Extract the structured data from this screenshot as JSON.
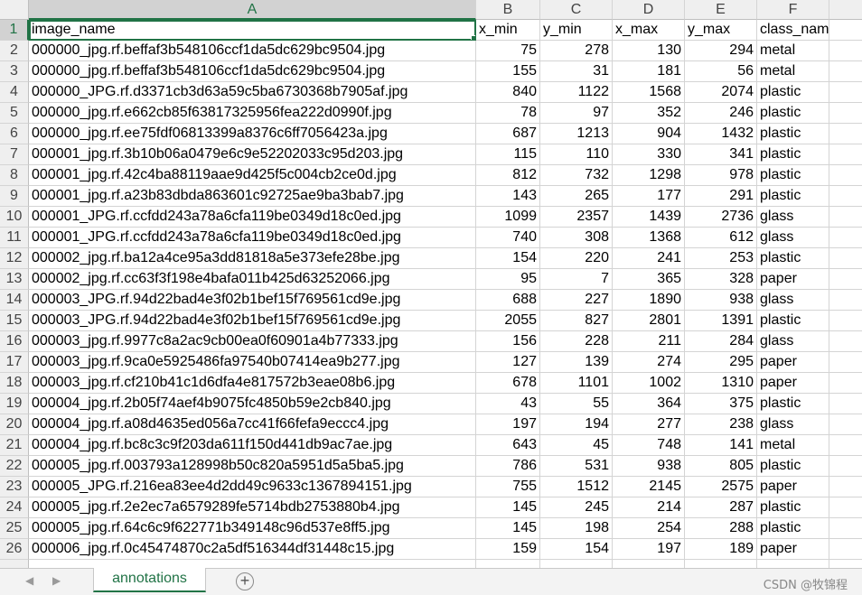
{
  "columns": [
    "A",
    "B",
    "C",
    "D",
    "E",
    "F"
  ],
  "header_row": {
    "num": "1",
    "image_name": "image_name",
    "x_min": "x_min",
    "y_min": "y_min",
    "x_max": "x_max",
    "y_max": "y_max",
    "class_name": "class_name"
  },
  "rows": [
    {
      "num": "2",
      "image_name": "000000_jpg.rf.beffaf3b548106ccf1da5dc629bc9504.jpg",
      "x_min": "75",
      "y_min": "278",
      "x_max": "130",
      "y_max": "294",
      "class_name": "metal"
    },
    {
      "num": "3",
      "image_name": "000000_jpg.rf.beffaf3b548106ccf1da5dc629bc9504.jpg",
      "x_min": "155",
      "y_min": "31",
      "x_max": "181",
      "y_max": "56",
      "class_name": "metal"
    },
    {
      "num": "4",
      "image_name": "000000_JPG.rf.d3371cb3d63a59c5ba6730368b7905af.jpg",
      "x_min": "840",
      "y_min": "1122",
      "x_max": "1568",
      "y_max": "2074",
      "class_name": "plastic"
    },
    {
      "num": "5",
      "image_name": "000000_jpg.rf.e662cb85f63817325956fea222d0990f.jpg",
      "x_min": "78",
      "y_min": "97",
      "x_max": "352",
      "y_max": "246",
      "class_name": "plastic"
    },
    {
      "num": "6",
      "image_name": "000000_jpg.rf.ee75fdf06813399a8376c6ff7056423a.jpg",
      "x_min": "687",
      "y_min": "1213",
      "x_max": "904",
      "y_max": "1432",
      "class_name": "plastic"
    },
    {
      "num": "7",
      "image_name": "000001_jpg.rf.3b10b06a0479e6c9e52202033c95d203.jpg",
      "x_min": "115",
      "y_min": "110",
      "x_max": "330",
      "y_max": "341",
      "class_name": "plastic"
    },
    {
      "num": "8",
      "image_name": "000001_jpg.rf.42c4ba88119aae9d425f5c004cb2ce0d.jpg",
      "x_min": "812",
      "y_min": "732",
      "x_max": "1298",
      "y_max": "978",
      "class_name": "plastic"
    },
    {
      "num": "9",
      "image_name": "000001_jpg.rf.a23b83dbda863601c92725ae9ba3bab7.jpg",
      "x_min": "143",
      "y_min": "265",
      "x_max": "177",
      "y_max": "291",
      "class_name": "plastic"
    },
    {
      "num": "10",
      "image_name": "000001_JPG.rf.ccfdd243a78a6cfa119be0349d18c0ed.jpg",
      "x_min": "1099",
      "y_min": "2357",
      "x_max": "1439",
      "y_max": "2736",
      "class_name": "glass"
    },
    {
      "num": "11",
      "image_name": "000001_JPG.rf.ccfdd243a78a6cfa119be0349d18c0ed.jpg",
      "x_min": "740",
      "y_min": "308",
      "x_max": "1368",
      "y_max": "612",
      "class_name": "glass"
    },
    {
      "num": "12",
      "image_name": "000002_jpg.rf.ba12a4ce95a3dd81818a5e373efe28be.jpg",
      "x_min": "154",
      "y_min": "220",
      "x_max": "241",
      "y_max": "253",
      "class_name": "plastic"
    },
    {
      "num": "13",
      "image_name": "000002_jpg.rf.cc63f3f198e4bafa011b425d63252066.jpg",
      "x_min": "95",
      "y_min": "7",
      "x_max": "365",
      "y_max": "328",
      "class_name": "paper"
    },
    {
      "num": "14",
      "image_name": "000003_JPG.rf.94d22bad4e3f02b1bef15f769561cd9e.jpg",
      "x_min": "688",
      "y_min": "227",
      "x_max": "1890",
      "y_max": "938",
      "class_name": "glass"
    },
    {
      "num": "15",
      "image_name": "000003_JPG.rf.94d22bad4e3f02b1bef15f769561cd9e.jpg",
      "x_min": "2055",
      "y_min": "827",
      "x_max": "2801",
      "y_max": "1391",
      "class_name": "plastic"
    },
    {
      "num": "16",
      "image_name": "000003_jpg.rf.9977c8a2ac9cb00ea0f60901a4b77333.jpg",
      "x_min": "156",
      "y_min": "228",
      "x_max": "211",
      "y_max": "284",
      "class_name": "glass"
    },
    {
      "num": "17",
      "image_name": "000003_jpg.rf.9ca0e5925486fa97540b07414ea9b277.jpg",
      "x_min": "127",
      "y_min": "139",
      "x_max": "274",
      "y_max": "295",
      "class_name": "paper"
    },
    {
      "num": "18",
      "image_name": "000003_jpg.rf.cf210b41c1d6dfa4e817572b3eae08b6.jpg",
      "x_min": "678",
      "y_min": "1101",
      "x_max": "1002",
      "y_max": "1310",
      "class_name": "paper"
    },
    {
      "num": "19",
      "image_name": "000004_jpg.rf.2b05f74aef4b9075fc4850b59e2cb840.jpg",
      "x_min": "43",
      "y_min": "55",
      "x_max": "364",
      "y_max": "375",
      "class_name": "plastic"
    },
    {
      "num": "20",
      "image_name": "000004_jpg.rf.a08d4635ed056a7cc41f66fefa9eccc4.jpg",
      "x_min": "197",
      "y_min": "194",
      "x_max": "277",
      "y_max": "238",
      "class_name": "glass"
    },
    {
      "num": "21",
      "image_name": "000004_jpg.rf.bc8c3c9f203da611f150d441db9ac7ae.jpg",
      "x_min": "643",
      "y_min": "45",
      "x_max": "748",
      "y_max": "141",
      "class_name": "metal"
    },
    {
      "num": "22",
      "image_name": "000005_jpg.rf.003793a128998b50c820a5951d5a5ba5.jpg",
      "x_min": "786",
      "y_min": "531",
      "x_max": "938",
      "y_max": "805",
      "class_name": "plastic"
    },
    {
      "num": "23",
      "image_name": "000005_JPG.rf.216ea83ee4d2dd49c9633c1367894151.jpg",
      "x_min": "755",
      "y_min": "1512",
      "x_max": "2145",
      "y_max": "2575",
      "class_name": "paper"
    },
    {
      "num": "24",
      "image_name": "000005_jpg.rf.2e2ec7a6579289fe5714bdb2753880b4.jpg",
      "x_min": "145",
      "y_min": "245",
      "x_max": "214",
      "y_max": "287",
      "class_name": "plastic"
    },
    {
      "num": "25",
      "image_name": "000005_jpg.rf.64c6c9f622771b349148c96d537e8ff5.jpg",
      "x_min": "145",
      "y_min": "198",
      "x_max": "254",
      "y_max": "288",
      "class_name": "plastic"
    },
    {
      "num": "26",
      "image_name": "000006_jpg.rf.0c45474870c2a5df516344df31448c15.jpg",
      "x_min": "159",
      "y_min": "154",
      "x_max": "197",
      "y_max": "189",
      "class_name": "paper"
    }
  ],
  "sheet_tab": "annotations",
  "add_sheet_symbol": "+",
  "nav": {
    "prev_icon": "◀",
    "next_icon": "▶"
  },
  "watermark": "CSDN @牧锦程",
  "colors": {
    "accent": "#217346",
    "gridline": "#d4d4d4",
    "header_bg": "#efefef"
  }
}
